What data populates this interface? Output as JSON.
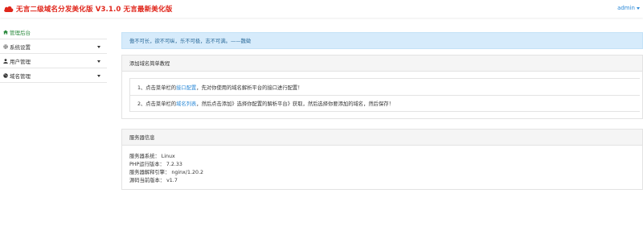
{
  "header": {
    "title": "无言二级域名分发美化版 V3.1.0 无言最新美化版",
    "user": "admin"
  },
  "sidebar": {
    "items": [
      {
        "label": "管理后台",
        "icon": "home-icon",
        "active": true
      },
      {
        "label": "系统设置",
        "icon": "gear-icon",
        "active": false
      },
      {
        "label": "用户管理",
        "icon": "user-icon",
        "active": false
      },
      {
        "label": "域名管理",
        "icon": "globe-icon",
        "active": false
      }
    ]
  },
  "alert": {
    "text": "傲不可长，欲不可纵，乐不可极，志不可满。——魏徵"
  },
  "tutorial": {
    "heading": "添加域名简单教程",
    "step1": {
      "prefix": "1、点击菜单栏的",
      "link": "接口配置",
      "suffix": "，先对你使用的域名解析平台的接口进行配置！"
    },
    "step2": {
      "prefix": "2、点击菜单栏的",
      "link": "域名列表",
      "suffix": "，然后点击添加》选择你配置的解析平台》获取，然后选择你要添加的域名，然后保存！"
    }
  },
  "server": {
    "heading": "服务器信息",
    "lines": [
      "服务器系统： Linux",
      "PHP运行版本： 7.2.33",
      "服务器解释引擎： nginx/1.20.2",
      "源码当前版本： v1.7"
    ]
  },
  "colors": {
    "brand": "#e0261b",
    "link": "#2e8bd8",
    "active": "#2b8a3e",
    "alert_bg": "#d6ebfb"
  }
}
